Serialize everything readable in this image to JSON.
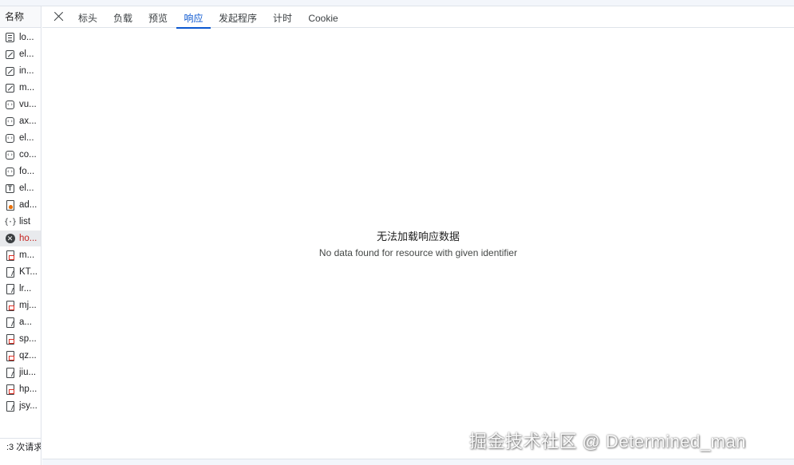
{
  "sidebar": {
    "header": "名称",
    "requests": [
      {
        "name": "lo...",
        "icon": "document-icon"
      },
      {
        "name": "el...",
        "icon": "stylesheet-icon"
      },
      {
        "name": "in...",
        "icon": "stylesheet-icon"
      },
      {
        "name": "m...",
        "icon": "stylesheet-icon"
      },
      {
        "name": "vu...",
        "icon": "script-icon"
      },
      {
        "name": "ax...",
        "icon": "script-icon"
      },
      {
        "name": "el...",
        "icon": "script-icon"
      },
      {
        "name": "co...",
        "icon": "script-icon"
      },
      {
        "name": "fo...",
        "icon": "script-icon"
      },
      {
        "name": "el...",
        "icon": "font-icon"
      },
      {
        "name": "ad...",
        "icon": "image-icon"
      },
      {
        "name": "list",
        "icon": "fetch-icon"
      },
      {
        "name": "ho...",
        "icon": "error-icon",
        "selected": true
      },
      {
        "name": "m...",
        "icon": "file-icon"
      },
      {
        "name": "KT...",
        "icon": "file-icon"
      },
      {
        "name": "lr...",
        "icon": "file-icon"
      },
      {
        "name": "mj...",
        "icon": "file-icon"
      },
      {
        "name": "a...",
        "icon": "file-icon"
      },
      {
        "name": "sp...",
        "icon": "file-icon"
      },
      {
        "name": "qz...",
        "icon": "file-icon"
      },
      {
        "name": "jiu...",
        "icon": "file-icon"
      },
      {
        "name": "hp...",
        "icon": "file-icon"
      },
      {
        "name": "jsy...",
        "icon": "file-icon"
      }
    ],
    "footer": ":3 次请求"
  },
  "tabs": [
    {
      "label": "标头"
    },
    {
      "label": "负载"
    },
    {
      "label": "预览"
    },
    {
      "label": "响应",
      "active": true
    },
    {
      "label": "发起程序"
    },
    {
      "label": "计时"
    },
    {
      "label": "Cookie"
    }
  ],
  "response": {
    "title": "无法加载响应数据",
    "message": "No data found for resource with given identifier"
  },
  "watermark": "掘金技术社区 @ Determined_man",
  "colors": {
    "accent": "#0b57d0",
    "error_text": "#c5221f",
    "selected_row_bg": "#e8eaed"
  }
}
